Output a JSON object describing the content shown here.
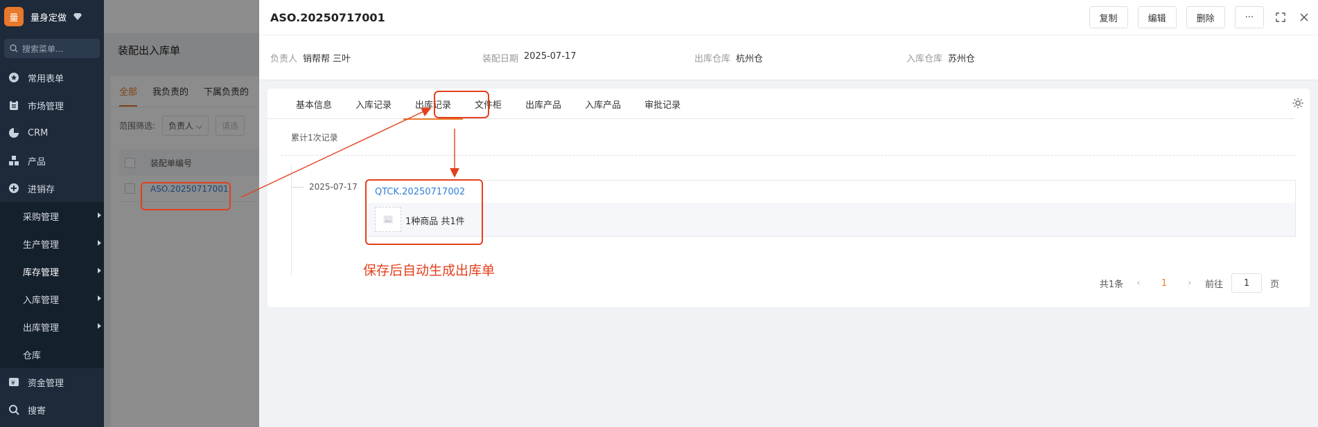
{
  "sidebar": {
    "brand_logo": "量",
    "brand_name": "量身定做",
    "search_placeholder": "搜索菜单...",
    "items": [
      {
        "label": "常用表单",
        "icon": "star-icon"
      },
      {
        "label": "市场管理",
        "icon": "market-icon"
      },
      {
        "label": "CRM",
        "icon": "crm-icon"
      },
      {
        "label": "产品",
        "icon": "product-icon"
      },
      {
        "label": "进销存",
        "icon": "inventory-icon"
      }
    ],
    "sub_items": [
      "采购管理",
      "生产管理",
      "库存管理",
      "入库管理",
      "出库管理",
      "仓库"
    ],
    "bottom_items": [
      {
        "label": "资金管理",
        "icon": "finance-icon"
      },
      {
        "label": "搜寄",
        "icon": "search-icon"
      }
    ]
  },
  "background": {
    "page_title": "装配出入库单",
    "tabs": [
      "全部",
      "我负责的",
      "下属负责的"
    ],
    "filter_label": "范围筛选:",
    "filter_select": "负责人",
    "filter_placeholder": "请选",
    "column_header": "装配单编号",
    "row_code": "ASO.20250717001"
  },
  "drawer": {
    "title": "ASO.20250717001",
    "actions": {
      "copy": "复制",
      "edit": "编辑",
      "delete": "删除",
      "more": "···"
    },
    "summary": [
      {
        "label": "负责人",
        "value": "销帮帮 三叶"
      },
      {
        "label": "装配日期",
        "value": "2025-07-17"
      },
      {
        "label": "出库仓库",
        "value": "杭州仓"
      },
      {
        "label": "入库仓库",
        "value": "苏州仓"
      }
    ],
    "tabs": [
      "基本信息",
      "入库记录",
      "出库记录",
      "文件柜",
      "出库产品",
      "入库产品",
      "审批记录"
    ],
    "active_tab": "出库记录",
    "records_count": "累计1次记录",
    "record": {
      "date": "2025-07-17",
      "code": "QTCK.20250717002",
      "summary": "1种商品 共1件"
    },
    "annotation": "保存后自动生成出库单",
    "pagination": {
      "total": "共1条",
      "current": "1",
      "goto_label": "前往",
      "goto_value": "1",
      "page_suffix": "页"
    }
  },
  "colors": {
    "accent": "#e8782a",
    "annotation": "#e2401d",
    "link": "#2f7ed8",
    "sidebar_bg": "#1e2a3a"
  }
}
